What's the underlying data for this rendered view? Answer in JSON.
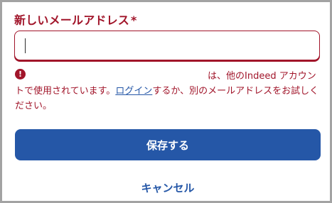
{
  "form": {
    "label": "新しいメールアドレス",
    "required_mark": "*",
    "email_value": "",
    "error": {
      "icon": "error-exclamation-icon",
      "text_before": "は、他のIndeed アカウントで使用されています。",
      "login_link": "ログイン",
      "text_after": "するか、別のメールアドレスをお試しください。"
    },
    "save_label": "保存する",
    "cancel_label": "キャンセル"
  },
  "colors": {
    "error": "#a1152a",
    "primary": "#2557a7",
    "frame_border": "#a3a3a3"
  }
}
